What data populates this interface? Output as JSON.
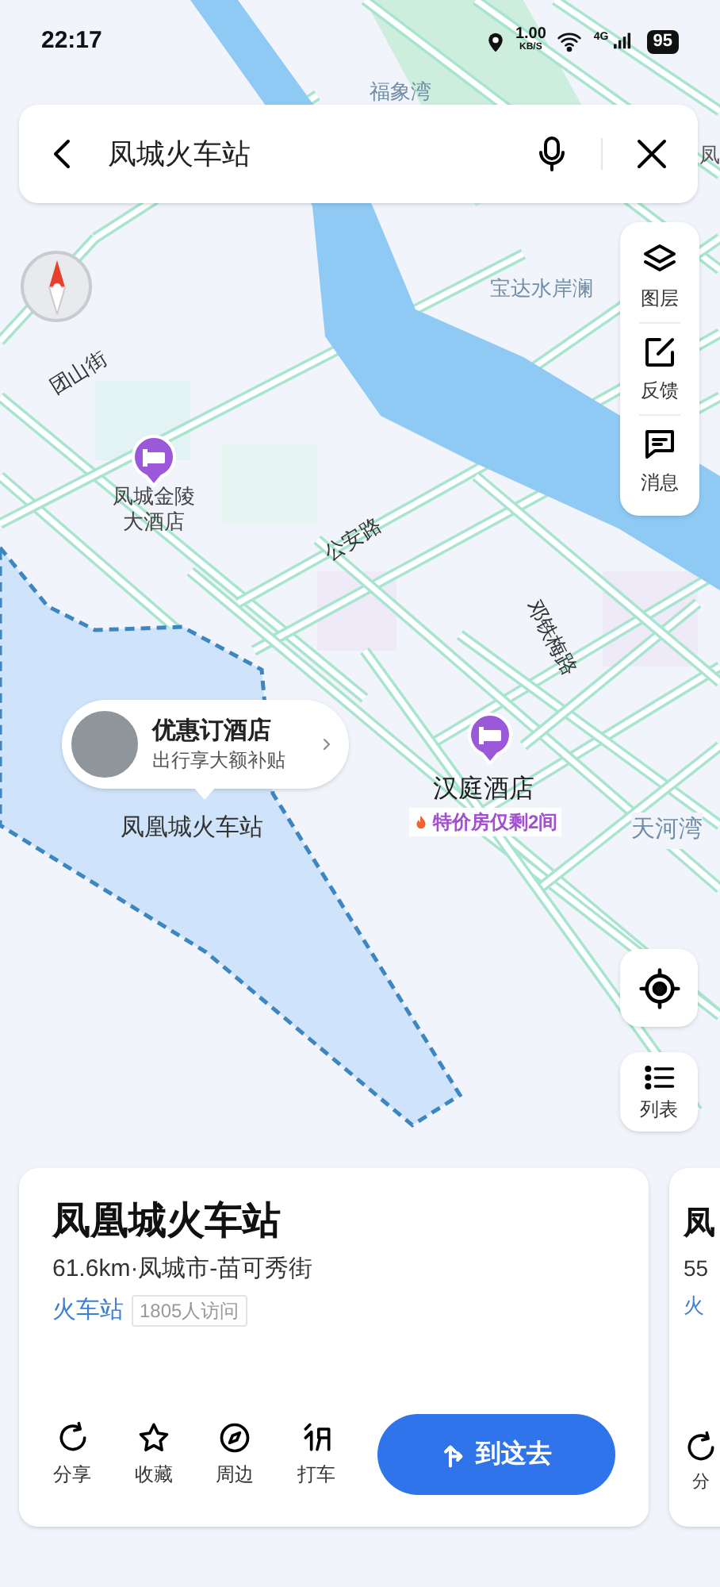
{
  "status_bar": {
    "time": "22:17",
    "net_speed": "1.00",
    "net_unit": "KB/S",
    "network": "4G",
    "battery": "95"
  },
  "search": {
    "value": "凤城火车站"
  },
  "map_labels": [
    {
      "kind": "area",
      "text": "福象湾"
    },
    {
      "kind": "area",
      "text": "宝达水岸澜"
    },
    {
      "kind": "road",
      "text": "团山街"
    },
    {
      "kind": "road",
      "text": "公安路"
    },
    {
      "kind": "road",
      "text": "邓铁梅路"
    },
    {
      "kind": "area",
      "text": "天河湾"
    },
    {
      "kind": "edge",
      "text": "凤"
    },
    {
      "kind": "station",
      "text": "凤凰城火车站"
    }
  ],
  "hotel_pins": [
    {
      "name": "凤城金陵大酒店"
    },
    {
      "name": "汉庭酒店",
      "promo": "特价房仅剩2间"
    }
  ],
  "hotel_callout": {
    "title": "优惠订酒店",
    "subtitle": "出行享大额补贴"
  },
  "map_tools": [
    {
      "kind": "layers",
      "label": "图层"
    },
    {
      "kind": "feedback",
      "label": "反馈"
    },
    {
      "kind": "message",
      "label": "消息"
    }
  ],
  "list_button": {
    "label": "列表"
  },
  "cards": [
    {
      "title": "凤凰城火车站",
      "info": "61.6km·凤城市-苗可秀街",
      "category": "火车站",
      "visits": "1805人访问",
      "actions": [
        {
          "kind": "share",
          "label": "分享"
        },
        {
          "kind": "star",
          "label": "收藏"
        },
        {
          "kind": "nearby",
          "label": "周边"
        },
        {
          "kind": "taxi",
          "label": "打车"
        }
      ],
      "go": "到这去"
    },
    {
      "title": "凤",
      "info": "55",
      "category": "火",
      "actions": [
        {
          "kind": "share",
          "label": "分"
        }
      ]
    }
  ]
}
